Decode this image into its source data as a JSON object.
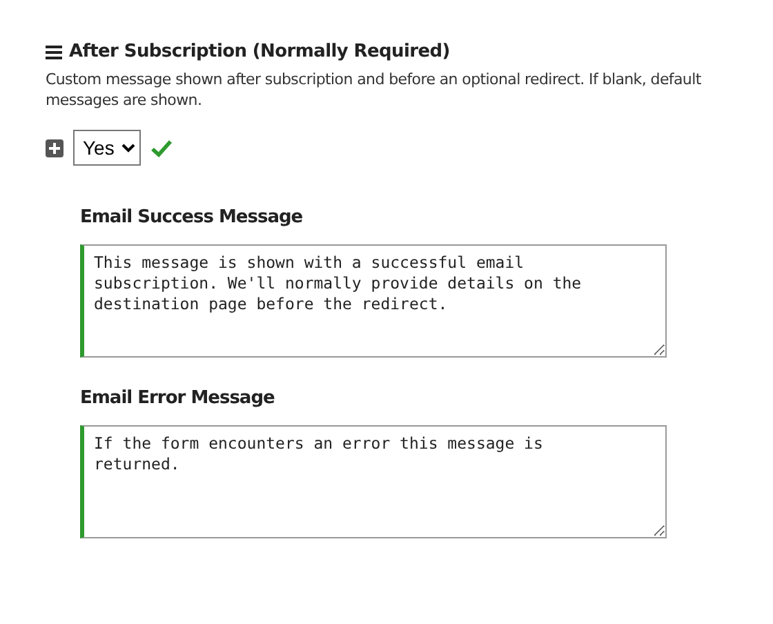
{
  "section": {
    "title": "After Subscription (Normally Required)",
    "description": "Custom message shown after subscription and before an optional redirect. If blank, default messages are shown.",
    "select": {
      "value": "Yes",
      "valid": true
    },
    "fields": [
      {
        "label": "Email Success Message",
        "value": "This message is shown with a successful email subscription. We'll normally provide details on the destination page before the redirect.",
        "valid": true
      },
      {
        "label": "Email Error Message",
        "value": "If the form encounters an error this message is returned.",
        "valid": true
      }
    ]
  }
}
